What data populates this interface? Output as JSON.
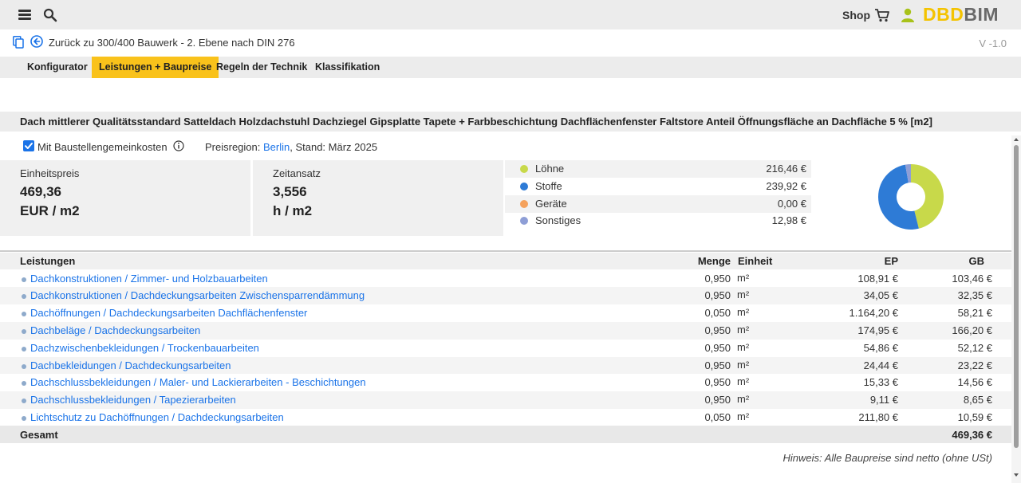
{
  "header": {
    "shop_label": "Shop",
    "logo_left": "DBD",
    "logo_right": "BIM",
    "icons": [
      "hamburger-menu-icon",
      "search-icon",
      "cart-icon",
      "user-icon"
    ],
    "logo_color": "#f4c300"
  },
  "nav": {
    "back_label": "Zurück zu 300/400 Bauwerk - 2. Ebene nach DIN 276",
    "version": "V -1.0"
  },
  "tabs": [
    {
      "label": "Konfigurator",
      "active": false
    },
    {
      "label": "Leistungen + Baupreise",
      "active": true
    },
    {
      "label": "Regeln der Technik",
      "active": false
    },
    {
      "label": "Klassifikation",
      "active": false
    }
  ],
  "item_title": "Dach mittlerer Qualitätsstandard Satteldach Holzdachstuhl Dachziegel Gipsplatte Tapete + Farbbeschichtung Dachflächenfenster Faltstore Anteil Öffnungsfläche an Dachfläche 5 % [m2]",
  "options": {
    "checkbox_label": "Mit Baustellengemeinkosten",
    "checkbox_checked": true,
    "region_prefix": "Preisregion: ",
    "region_link": "Berlin",
    "region_suffix": ", Stand: März 2025"
  },
  "stats": {
    "unit_price": {
      "label": "Einheitspreis",
      "value": "469,36",
      "unit": "EUR / m2"
    },
    "time": {
      "label": "Zeitansatz",
      "value": "3,556",
      "unit": "h / m2"
    }
  },
  "cost_breakdown": [
    {
      "name": "Löhne",
      "value": "216,46 €",
      "color": "#c8d94a"
    },
    {
      "name": "Stoffe",
      "value": "239,92 €",
      "color": "#2e7bd6"
    },
    {
      "name": "Geräte",
      "value": "0,00 €",
      "color": "#f5a25d"
    },
    {
      "name": "Sonstiges",
      "value": "12,98 €",
      "color": "#8e9ed6"
    }
  ],
  "chart_data": {
    "type": "pie",
    "categories": [
      "Löhne",
      "Stoffe",
      "Geräte",
      "Sonstiges"
    ],
    "values": [
      216.46,
      239.92,
      0.0,
      12.98
    ],
    "colors": [
      "#c8d94a",
      "#2e7bd6",
      "#f5a25d",
      "#8e9ed6"
    ],
    "title": "",
    "donut": true
  },
  "table": {
    "headers": {
      "leistungen": "Leistungen",
      "menge": "Menge",
      "einheit": "Einheit",
      "ep": "EP",
      "gb": "GB"
    },
    "rows": [
      {
        "name": "Dachkonstruktionen / Zimmer- und Holzbauarbeiten",
        "menge": "0,950",
        "einheit": "m²",
        "ep": "108,91 €",
        "gb": "103,46 €"
      },
      {
        "name": "Dachkonstruktionen / Dachdeckungsarbeiten Zwischensparrendämmung",
        "menge": "0,950",
        "einheit": "m²",
        "ep": "34,05 €",
        "gb": "32,35 €"
      },
      {
        "name": "Dachöffnungen / Dachdeckungsarbeiten Dachflächenfenster",
        "menge": "0,050",
        "einheit": "m²",
        "ep": "1.164,20 €",
        "gb": "58,21 €"
      },
      {
        "name": "Dachbeläge / Dachdeckungsarbeiten",
        "menge": "0,950",
        "einheit": "m²",
        "ep": "174,95 €",
        "gb": "166,20 €"
      },
      {
        "name": "Dachzwischenbekleidungen / Trockenbauarbeiten",
        "menge": "0,950",
        "einheit": "m²",
        "ep": "54,86 €",
        "gb": "52,12 €"
      },
      {
        "name": "Dachbekleidungen / Dachdeckungsarbeiten",
        "menge": "0,950",
        "einheit": "m²",
        "ep": "24,44 €",
        "gb": "23,22 €"
      },
      {
        "name": "Dachschlussbekleidungen / Maler- und Lackierarbeiten - Beschichtungen",
        "menge": "0,950",
        "einheit": "m²",
        "ep": "15,33 €",
        "gb": "14,56 €"
      },
      {
        "name": "Dachschlussbekleidungen / Tapezierarbeiten",
        "menge": "0,950",
        "einheit": "m²",
        "ep": "9,11 €",
        "gb": "8,65 €"
      },
      {
        "name": "Lichtschutz zu Dachöffnungen / Dachdeckungsarbeiten",
        "menge": "0,050",
        "einheit": "m²",
        "ep": "211,80 €",
        "gb": "10,59 €"
      }
    ],
    "total_label": "Gesamt",
    "total_value": "469,36 €"
  },
  "note": "Hinweis: Alle Baupreise sind netto (ohne USt)"
}
